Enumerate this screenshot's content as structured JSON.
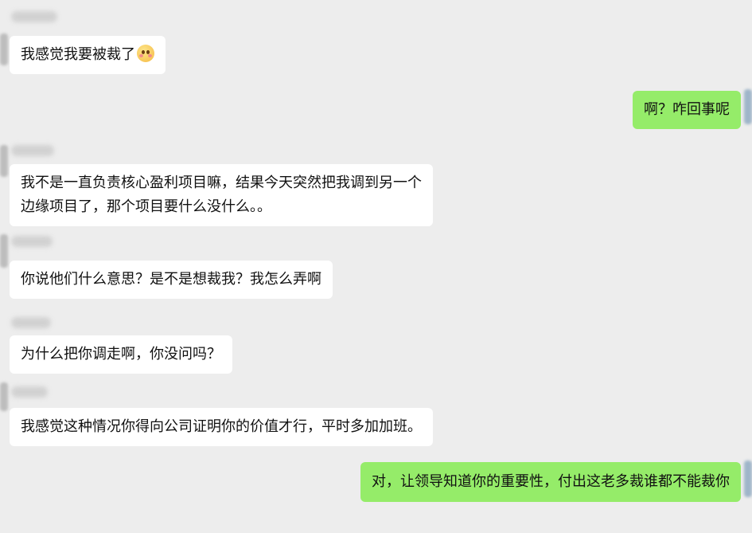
{
  "messages": [
    {
      "side": "in",
      "lines": [
        "我感觉我要被裁了"
      ],
      "emoji": "flushed-face-icon"
    },
    {
      "side": "out",
      "lines": [
        "啊？咋回事呢"
      ]
    },
    {
      "side": "in",
      "lines": [
        "我不是一直负责核心盈利项目嘛，结果今天突然把我调到另一个",
        "边缘项目了，那个项目要什么没什么。。"
      ]
    },
    {
      "side": "in",
      "lines": [
        "你说他们什么意思？是不是想裁我？我怎么弄啊"
      ]
    },
    {
      "side": "in",
      "lines": [
        "为什么把你调走啊，你没问吗？"
      ]
    },
    {
      "side": "in",
      "lines": [
        "我感觉这种情况你得向公司证明你的价值才行，平时多加加班。"
      ]
    },
    {
      "side": "out",
      "lines": [
        "对，让领导知道你的重要性，付出这老多裁谁都不能裁你"
      ]
    }
  ],
  "colors": {
    "background": "#ededed",
    "incoming_bubble": "#ffffff",
    "outgoing_bubble": "#95ec69"
  }
}
